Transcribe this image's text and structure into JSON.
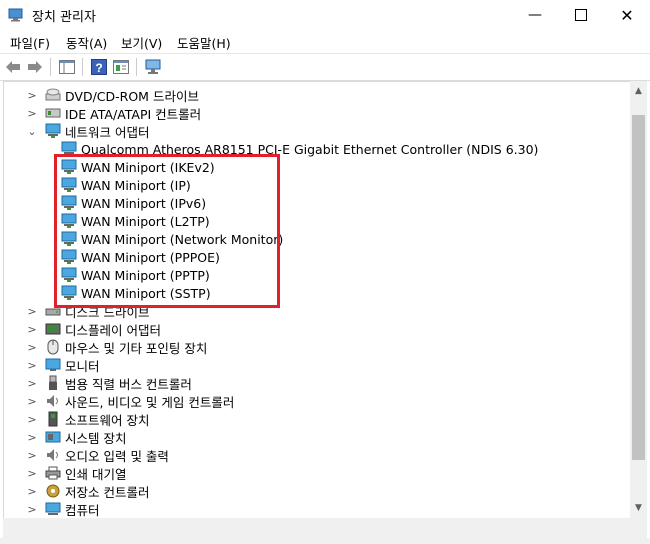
{
  "window": {
    "title": "장치 관리자"
  },
  "menu": [
    "파일(F)",
    "동작(A)",
    "보기(V)",
    "도움말(H)"
  ],
  "tree": [
    {
      "label": "DVD/CD-ROM 드라이브",
      "expanded": false,
      "level": 0,
      "icon": "dvd-drive-icon"
    },
    {
      "label": "IDE ATA/ATAPI 컨트롤러",
      "expanded": false,
      "level": 0,
      "icon": "ide-controller-icon"
    },
    {
      "label": "네트워크 어댑터",
      "expanded": true,
      "level": 0,
      "icon": "network-adapter-icon"
    },
    {
      "label": "Qualcomm Atheros AR8151 PCI-E Gigabit Ethernet Controller (NDIS 6.30)",
      "level": 1,
      "icon": "network-adapter-icon"
    },
    {
      "label": "WAN Miniport (IKEv2)",
      "level": 1,
      "icon": "network-adapter-icon"
    },
    {
      "label": "WAN Miniport (IP)",
      "level": 1,
      "icon": "network-adapter-icon"
    },
    {
      "label": "WAN Miniport (IPv6)",
      "level": 1,
      "icon": "network-adapter-icon"
    },
    {
      "label": "WAN Miniport (L2TP)",
      "level": 1,
      "icon": "network-adapter-icon"
    },
    {
      "label": "WAN Miniport (Network Monitor)",
      "level": 1,
      "icon": "network-adapter-icon"
    },
    {
      "label": "WAN Miniport (PPPOE)",
      "level": 1,
      "icon": "network-adapter-icon"
    },
    {
      "label": "WAN Miniport (PPTP)",
      "level": 1,
      "icon": "network-adapter-icon"
    },
    {
      "label": "WAN Miniport (SSTP)",
      "level": 1,
      "icon": "network-adapter-icon"
    },
    {
      "label": "디스크 드라이브",
      "expanded": false,
      "level": 0,
      "icon": "disk-drive-icon"
    },
    {
      "label": "디스플레이 어댑터",
      "expanded": false,
      "level": 0,
      "icon": "display-adapter-icon"
    },
    {
      "label": "마우스 및 기타 포인팅 장치",
      "expanded": false,
      "level": 0,
      "icon": "mouse-icon"
    },
    {
      "label": "모니터",
      "expanded": false,
      "level": 0,
      "icon": "monitor-icon"
    },
    {
      "label": "범용 직렬 버스 컨트롤러",
      "expanded": false,
      "level": 0,
      "icon": "usb-icon"
    },
    {
      "label": "사운드, 비디오 및 게임 컨트롤러",
      "expanded": false,
      "level": 0,
      "icon": "speaker-icon"
    },
    {
      "label": "소프트웨어 장치",
      "expanded": false,
      "level": 0,
      "icon": "software-device-icon"
    },
    {
      "label": "시스템 장치",
      "expanded": false,
      "level": 0,
      "icon": "system-device-icon"
    },
    {
      "label": "오디오 입력 및 출력",
      "expanded": false,
      "level": 0,
      "icon": "audio-io-icon"
    },
    {
      "label": "인쇄 대기열",
      "expanded": false,
      "level": 0,
      "icon": "printer-icon"
    },
    {
      "label": "저장소 컨트롤러",
      "expanded": false,
      "level": 0,
      "icon": "storage-controller-icon"
    },
    {
      "label": "컴퓨터",
      "expanded": false,
      "level": 0,
      "icon": "computer-icon"
    }
  ],
  "highlight_color": "#e0202a"
}
